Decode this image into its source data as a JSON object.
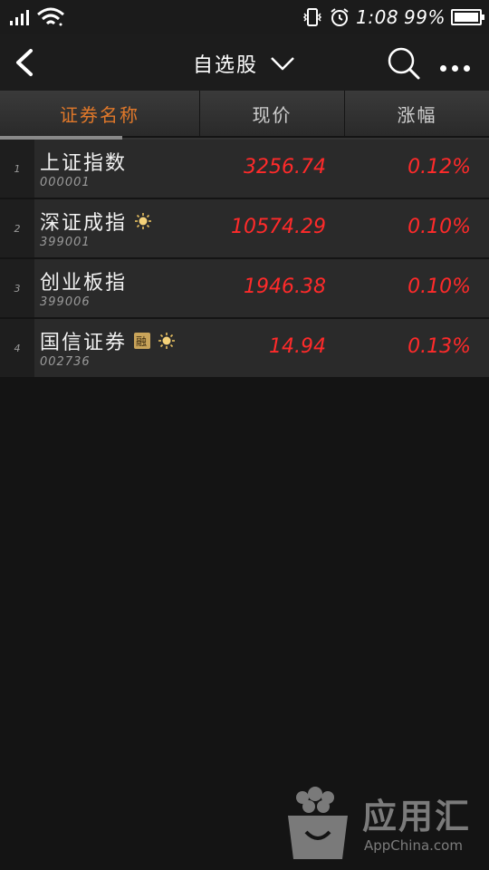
{
  "status_bar": {
    "time": "1:08",
    "battery_percent": "99%",
    "battery_level": 0.99,
    "icons": [
      "signal-icon",
      "wifi-icon",
      "vibrate-icon",
      "alarm-icon",
      "battery-icon"
    ]
  },
  "header": {
    "title": "自选股",
    "back_icon": "chevron-left-icon",
    "dropdown_icon": "chevron-down-icon",
    "search_icon": "search-icon",
    "more_icon": "more-dots-icon"
  },
  "tabs": [
    {
      "label": "证券名称",
      "active": true
    },
    {
      "label": "现价",
      "active": false
    },
    {
      "label": "涨幅",
      "active": false
    }
  ],
  "colors": {
    "accent": "#e0782a",
    "up": "#ff2a2a",
    "background": "#141414",
    "row": "#2a2a2a"
  },
  "stocks": [
    {
      "index": "1",
      "name": "上证指数",
      "code": "000001",
      "price": "3256.74",
      "change": "0.12%",
      "badges": []
    },
    {
      "index": "2",
      "name": "深证成指",
      "code": "399001",
      "price": "10574.29",
      "change": "0.10%",
      "badges": [
        "sun-icon"
      ]
    },
    {
      "index": "3",
      "name": "创业板指",
      "code": "399006",
      "price": "1946.38",
      "change": "0.10%",
      "badges": []
    },
    {
      "index": "4",
      "name": "国信证券",
      "code": "002736",
      "price": "14.94",
      "change": "0.13%",
      "badges": [
        "margin-badge",
        "sun-icon"
      ],
      "margin_label": "融"
    }
  ],
  "watermark": {
    "title": "应用汇",
    "subtitle": "AppChina.com"
  }
}
